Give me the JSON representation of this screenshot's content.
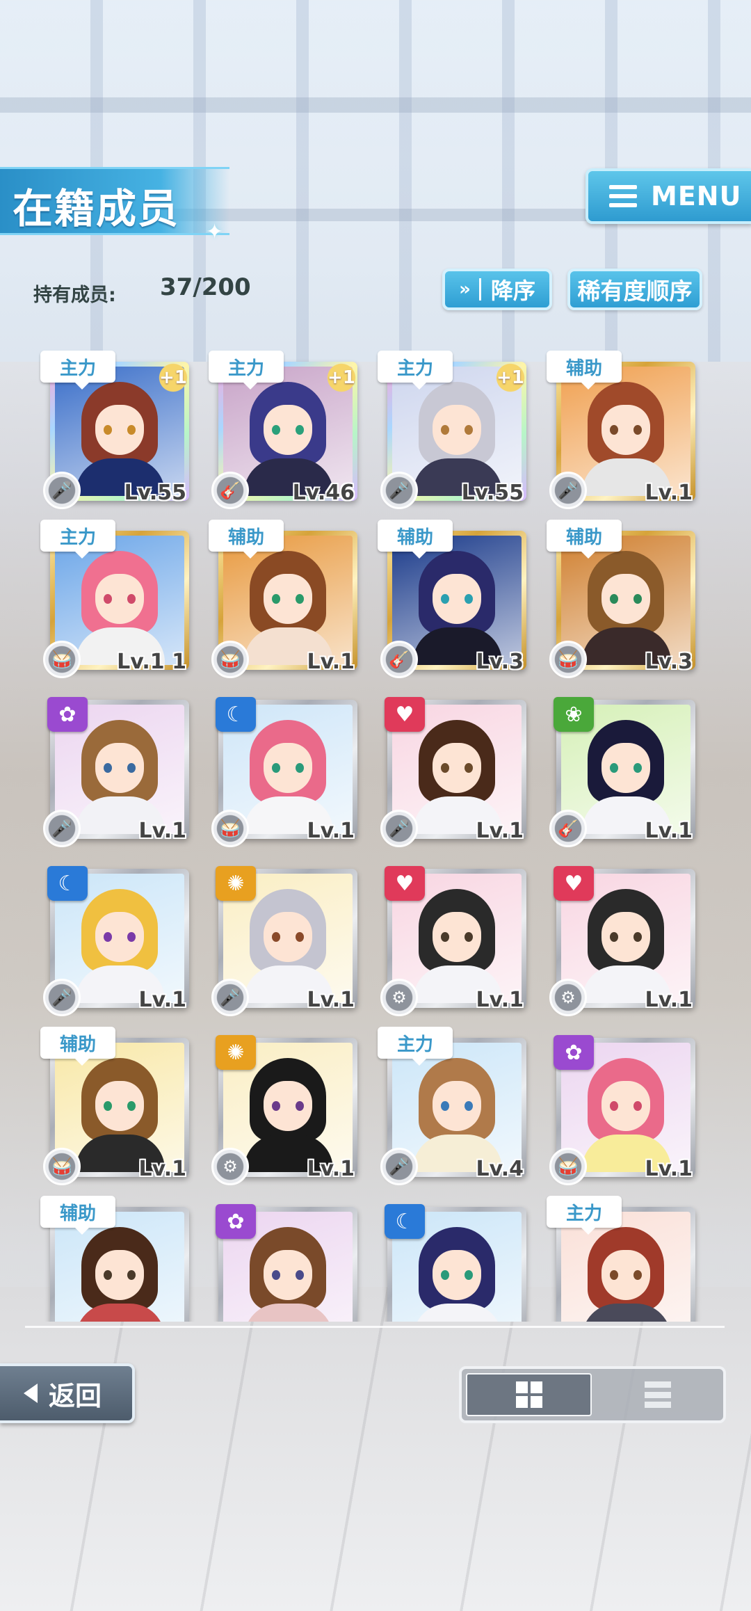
{
  "header": {
    "title": "在籍成员",
    "menu_label": "MENU",
    "member_count_label": "持有成员:",
    "member_count": "37/200",
    "sort_order_label": "降序",
    "sort_order_chevron": "»",
    "sort_rarity_label": "稀有度顺序"
  },
  "cards": [
    {
      "role": "主力",
      "attr": "",
      "plus": "+1",
      "lv": "Lv.55",
      "type": "🎤",
      "frame": "rainbow",
      "hair": "#8b3a2a",
      "bg": "#3b6fc9",
      "eye": "#c88a2a",
      "body": "#1c2e6e"
    },
    {
      "role": "主力",
      "attr": "",
      "plus": "+1",
      "lv": "Lv.46",
      "type": "🎸",
      "frame": "rainbow",
      "hair": "#3a3a8a",
      "bg": "#c8a4c8",
      "eye": "#2aa07a",
      "body": "#2a2a4a"
    },
    {
      "role": "主力",
      "attr": "",
      "plus": "+1",
      "lv": "Lv.55",
      "type": "🎤",
      "frame": "rainbow",
      "hair": "#c8c8d4",
      "bg": "#ced6ee",
      "eye": "#b07a3a",
      "body": "#3a3a55"
    },
    {
      "role": "辅助",
      "attr": "",
      "plus": "",
      "lv": "Lv.1",
      "type": "🎤",
      "frame": "gold",
      "hair": "#a04a2a",
      "bg": "#f0a050",
      "eye": "#7a4a2a",
      "body": "#e6e6e6"
    },
    {
      "role": "主力",
      "attr": "",
      "plus": "",
      "lv": "Lv.1 1",
      "type": "🥁",
      "frame": "gold",
      "hair": "#f07090",
      "bg": "#6ca6e8",
      "eye": "#d04a6a",
      "body": "#f2f2f2"
    },
    {
      "role": "辅助",
      "attr": "",
      "plus": "",
      "lv": "Lv.1",
      "type": "🥁",
      "frame": "gold",
      "hair": "#8a4a24",
      "bg": "#e89a40",
      "eye": "#2a9a6a",
      "body": "#f4e0d0"
    },
    {
      "role": "辅助",
      "attr": "",
      "plus": "",
      "lv": "Lv.3",
      "type": "🎸",
      "frame": "gold",
      "hair": "#2a2a6a",
      "bg": "#1a3a8a",
      "eye": "#2aa0b0",
      "body": "#1a1a2a"
    },
    {
      "role": "辅助",
      "attr": "",
      "plus": "",
      "lv": "Lv.3",
      "type": "🥁",
      "frame": "gold",
      "hair": "#8a5a2a",
      "bg": "#d08030",
      "eye": "#2a8a5a",
      "body": "#3a2a2a"
    },
    {
      "role": "",
      "attr": "✿",
      "attrColor": "#9a4ad0",
      "plus": "",
      "lv": "Lv.1",
      "type": "🎤",
      "frame": "silver",
      "hair": "#9a6a3a",
      "bg": "#ecd6f0",
      "eye": "#3a6aa0",
      "body": "#f2f2f6"
    },
    {
      "role": "",
      "attr": "☾",
      "attrColor": "#2a7ad8",
      "plus": "",
      "lv": "Lv.1",
      "type": "🥁",
      "frame": "silver",
      "hair": "#ea6a8a",
      "bg": "#cfe6f8",
      "eye": "#2a9a7a",
      "body": "#f6f6f8"
    },
    {
      "role": "",
      "attr": "♥",
      "attrColor": "#e03a5a",
      "plus": "",
      "lv": "Lv.1",
      "type": "🎤",
      "frame": "silver",
      "hair": "#4a2a1a",
      "bg": "#f8d6e2",
      "eye": "#6a4a2a",
      "body": "#f4f4f8"
    },
    {
      "role": "",
      "attr": "❀",
      "attrColor": "#4aa83a",
      "plus": "",
      "lv": "Lv.1",
      "type": "🎸",
      "frame": "silver",
      "hair": "#1a1a3a",
      "bg": "#d6f0b8",
      "eye": "#2a9a7a",
      "body": "#f4f4f8"
    },
    {
      "role": "",
      "attr": "☾",
      "attrColor": "#2a7ad8",
      "plus": "",
      "lv": "Lv.1",
      "type": "🎤",
      "frame": "silver",
      "hair": "#f0c040",
      "bg": "#cce6f8",
      "eye": "#7a3aa8",
      "body": "#f4f4f8"
    },
    {
      "role": "",
      "attr": "✺",
      "attrColor": "#e8a020",
      "plus": "",
      "lv": "Lv.1",
      "type": "🎤",
      "frame": "silver",
      "hair": "#c4c4d0",
      "bg": "#faeec4",
      "eye": "#8a4a2a",
      "body": "#f4f4f8"
    },
    {
      "role": "",
      "attr": "♥",
      "attrColor": "#e03a5a",
      "plus": "",
      "lv": "Lv.1",
      "type": "⚙",
      "frame": "silver",
      "hair": "#2a2a2a",
      "bg": "#f8d6e2",
      "eye": "#4a3a2a",
      "body": "#f4f4f8"
    },
    {
      "role": "",
      "attr": "♥",
      "attrColor": "#e03a5a",
      "plus": "",
      "lv": "Lv.1",
      "type": "⚙",
      "frame": "silver",
      "hair": "#2a2a2a",
      "bg": "#f8d6e2",
      "eye": "#4a3a2a",
      "body": "#f4f4f8"
    },
    {
      "role": "辅助",
      "attr": "",
      "plus": "",
      "lv": "Lv.1",
      "type": "🥁",
      "frame": "silver",
      "hair": "#8a5a2a",
      "bg": "#f8e8a8",
      "eye": "#2a9a6a",
      "body": "#2a2a2a"
    },
    {
      "role": "",
      "attr": "✺",
      "attrColor": "#e8a020",
      "plus": "",
      "lv": "Lv.1",
      "type": "⚙",
      "frame": "silver",
      "hair": "#1a1a1a",
      "bg": "#faeec4",
      "eye": "#6a3a8a",
      "body": "#1a1a1a"
    },
    {
      "role": "主力",
      "attr": "",
      "plus": "",
      "lv": "Lv.4",
      "type": "🎤",
      "frame": "silver",
      "hair": "#b07a4a",
      "bg": "#cce6f8",
      "eye": "#3a7ab8",
      "body": "#f6eed6"
    },
    {
      "role": "",
      "attr": "✿",
      "attrColor": "#9a4ad0",
      "plus": "",
      "lv": "Lv.1",
      "type": "🥁",
      "frame": "silver",
      "hair": "#ea6a8a",
      "bg": "#ecd6f0",
      "eye": "#d04a6a",
      "body": "#f8ec9a"
    },
    {
      "role": "辅助",
      "attr": "",
      "plus": "",
      "lv": "",
      "type": "",
      "frame": "silver",
      "hair": "#4a2a1a",
      "bg": "#cce6f8",
      "eye": "#4a3a2a",
      "body": "#c84a4a"
    },
    {
      "role": "",
      "attr": "✿",
      "attrColor": "#9a4ad0",
      "plus": "",
      "lv": "",
      "type": "",
      "frame": "silver",
      "hair": "#7a4a2a",
      "bg": "#ecd6f0",
      "eye": "#4a4a8a",
      "body": "#e8c4c4"
    },
    {
      "role": "",
      "attr": "☾",
      "attrColor": "#2a7ad8",
      "plus": "",
      "lv": "",
      "type": "",
      "frame": "silver",
      "hair": "#2a2a6a",
      "bg": "#cce6f8",
      "eye": "#2a9a7a",
      "body": "#f4f4f8"
    },
    {
      "role": "主力",
      "attr": "",
      "plus": "",
      "lv": "",
      "type": "",
      "frame": "silver",
      "hair": "#a03a2a",
      "bg": "#fae0d8",
      "eye": "#7a4a2a",
      "body": "#4a4a5a"
    }
  ],
  "footer": {
    "back_label": "返回"
  },
  "colors": {
    "accent": "#2e9ed3",
    "role_text": "#3a98c9"
  }
}
